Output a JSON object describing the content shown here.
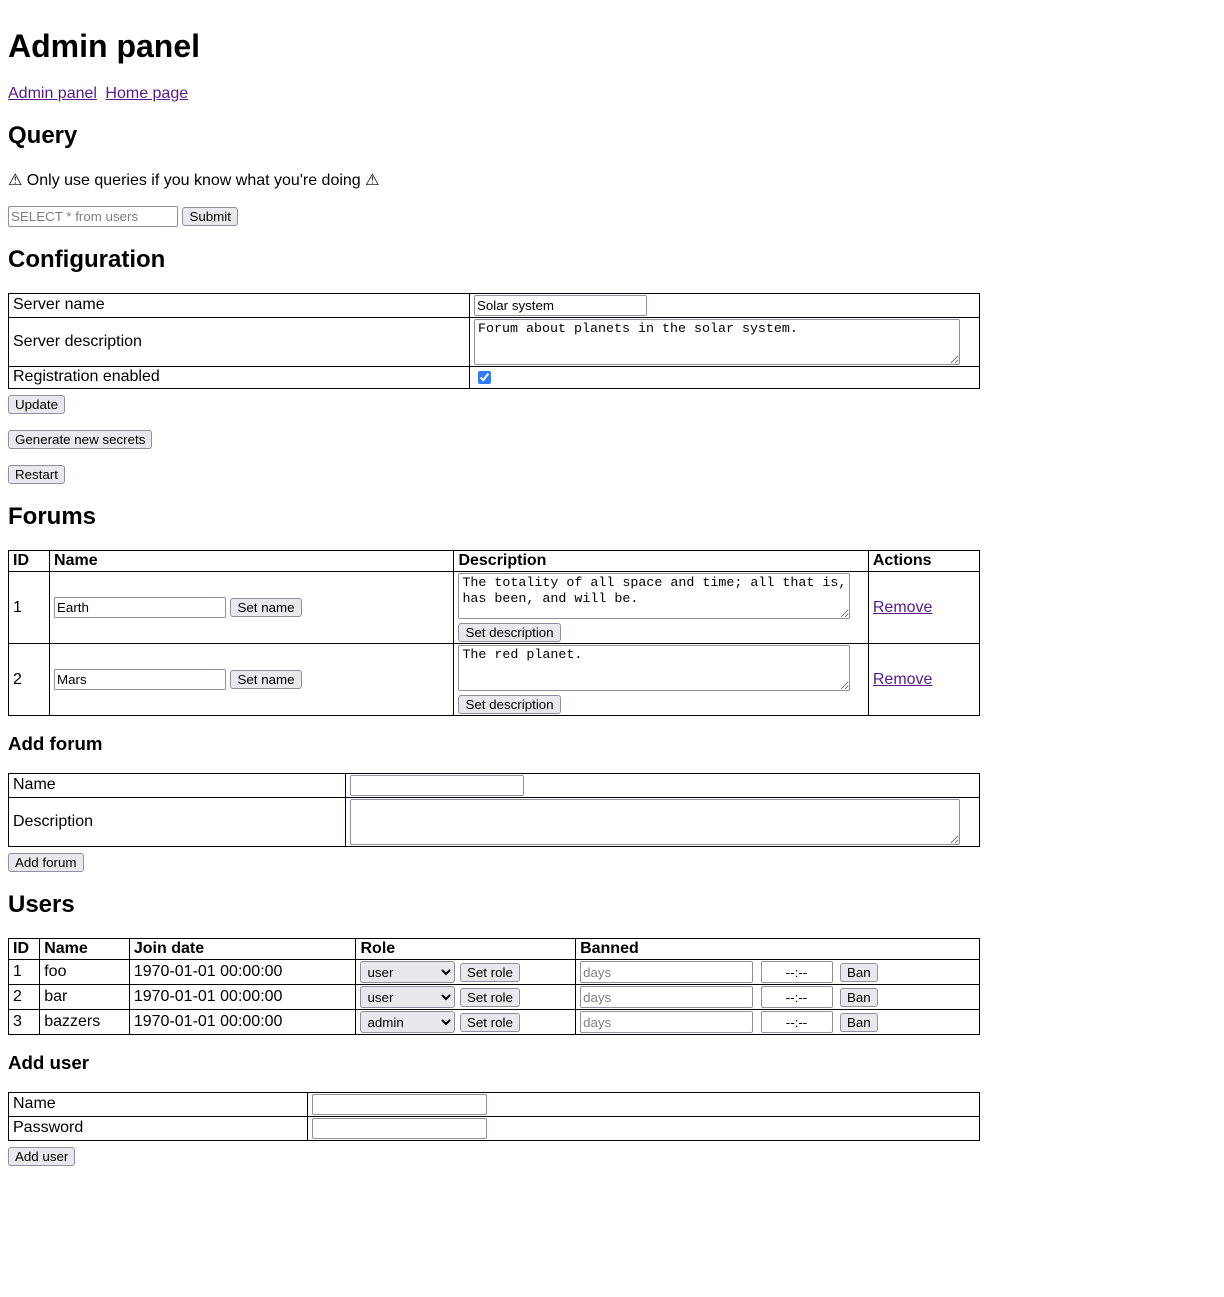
{
  "page": {
    "title": "Admin panel"
  },
  "nav": {
    "links": [
      {
        "label": "Admin panel"
      },
      {
        "label": "Home page"
      }
    ]
  },
  "query": {
    "heading": "Query",
    "warning": "⚠ Only use queries if you know what you're doing ⚠",
    "input_placeholder": "SELECT * from users",
    "input_value": "",
    "submit_label": "Submit"
  },
  "configuration": {
    "heading": "Configuration",
    "rows": [
      {
        "label": "Server name",
        "value": "Solar system"
      },
      {
        "label": "Server description",
        "value": "Forum about planets in the solar system."
      },
      {
        "label": "Registration enabled",
        "checked": true
      }
    ],
    "update_label": "Update",
    "generate_secrets_label": "Generate new secrets",
    "restart_label": "Restart"
  },
  "forums": {
    "heading": "Forums",
    "columns": [
      "ID",
      "Name",
      "Description",
      "Actions"
    ],
    "set_name_label": "Set name",
    "set_description_label": "Set description",
    "remove_label": "Remove",
    "rows": [
      {
        "id": "1",
        "name": "Earth",
        "description": "The totality of all space and time; all that is, has been, and will be."
      },
      {
        "id": "2",
        "name": "Mars",
        "description": "The red planet."
      }
    ]
  },
  "add_forum": {
    "heading": "Add forum",
    "name_label": "Name",
    "name_value": "",
    "description_label": "Description",
    "description_value": "",
    "button_label": "Add forum"
  },
  "users": {
    "heading": "Users",
    "columns": [
      "ID",
      "Name",
      "Join date",
      "Role",
      "Banned"
    ],
    "set_role_label": "Set role",
    "ban_label": "Ban",
    "days_placeholder": "days",
    "time_value": "--:--",
    "role_options": [
      "user",
      "admin"
    ],
    "rows": [
      {
        "id": "1",
        "name": "foo",
        "join_date": "1970-01-01 00:00:00",
        "role": "user"
      },
      {
        "id": "2",
        "name": "bar",
        "join_date": "1970-01-01 00:00:00",
        "role": "user"
      },
      {
        "id": "3",
        "name": "bazzers",
        "join_date": "1970-01-01 00:00:00",
        "role": "admin"
      }
    ]
  },
  "add_user": {
    "heading": "Add user",
    "name_label": "Name",
    "name_value": "",
    "password_label": "Password",
    "password_value": "",
    "button_label": "Add user"
  },
  "colors": {
    "link": "#551a8b",
    "accent_checkbox": "#2f7cf6",
    "button_bg": "#e9e9ed",
    "border": "#8f8f9d"
  }
}
